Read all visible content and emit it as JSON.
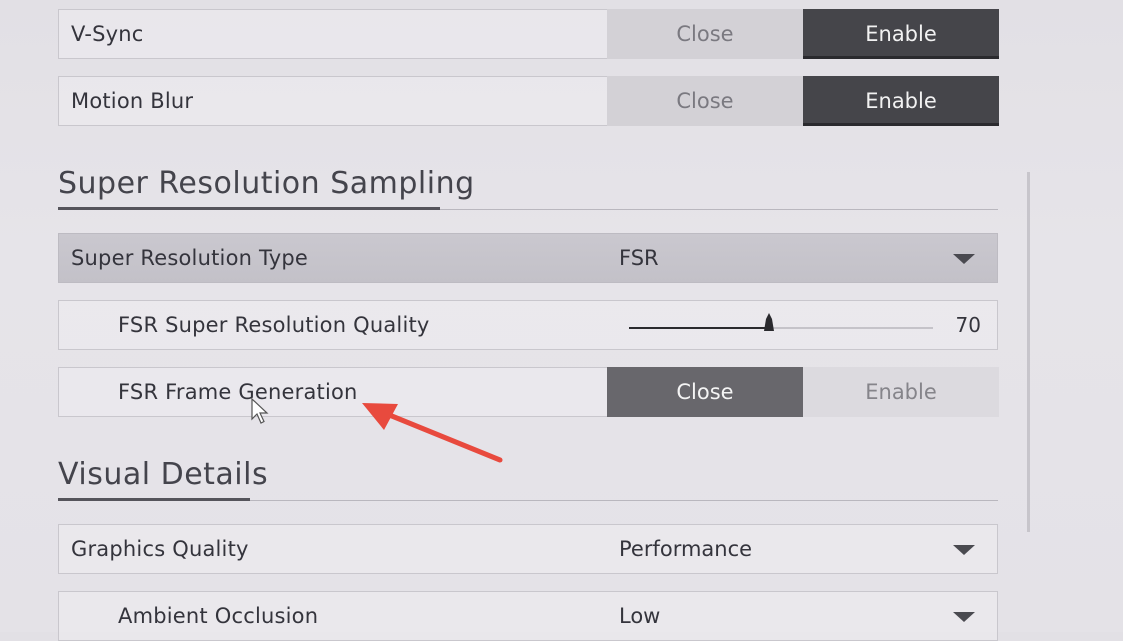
{
  "settings": {
    "vsync": {
      "label": "V-Sync",
      "option_off": "Close",
      "option_on": "Enable",
      "selected": "Enable"
    },
    "motion_blur": {
      "label": "Motion Blur",
      "option_off": "Close",
      "option_on": "Enable",
      "selected": "Enable"
    }
  },
  "sections": {
    "super_resolution": {
      "title": "Super Resolution Sampling",
      "type": {
        "label": "Super Resolution Type",
        "value": "FSR"
      },
      "quality": {
        "label": "FSR Super Resolution Quality",
        "value": "70",
        "fraction": 0.7
      },
      "frame_generation": {
        "label": "FSR Frame Generation",
        "option_off": "Close",
        "option_on": "Enable",
        "selected": "Close"
      }
    },
    "visual_details": {
      "title": "Visual Details",
      "graphics_quality": {
        "label": "Graphics Quality",
        "value": "Performance"
      },
      "ambient_occlusion": {
        "label": "Ambient Occlusion",
        "value": "Low"
      }
    }
  },
  "annotation": {
    "color": "#e84a3e"
  },
  "icons": {
    "dropdown": "caret-down-icon",
    "cursor": "mouse-pointer-icon",
    "slider_handle": "slider-handle-icon"
  }
}
